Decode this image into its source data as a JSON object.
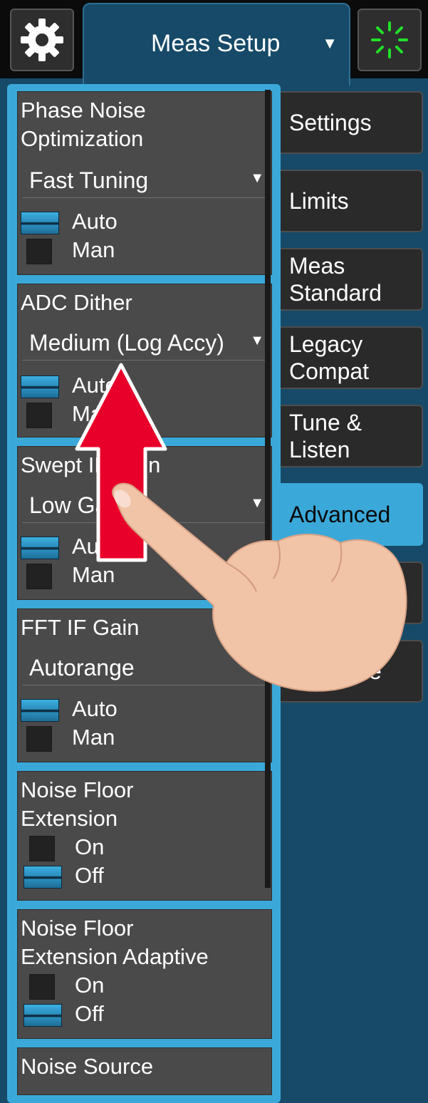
{
  "header": {
    "title": "Meas Setup",
    "title_caret": "▼",
    "settings_icon": "gear-icon",
    "status_icon": "busy-spinner-icon"
  },
  "side_menu": {
    "items": [
      {
        "label_1": "Settings",
        "label_2": ""
      },
      {
        "label_1": "Limits",
        "label_2": ""
      },
      {
        "label_1": "Meas",
        "label_2": "Standard"
      },
      {
        "label_1": "Legacy",
        "label_2": "Compat"
      },
      {
        "label_1": "Tune &",
        "label_2": "Listen"
      },
      {
        "label_1": "Advanced",
        "label_2": ""
      },
      {
        "label_1": "",
        "label_2": ""
      },
      {
        "label_1": "ce",
        "label_2": ""
      }
    ],
    "active": "Advanced"
  },
  "panels": {
    "phase_noise": {
      "title_1": "Phase Noise",
      "title_2": "Optimization",
      "value": "Fast Tuning",
      "caret": "▼",
      "auto": "Auto",
      "man": "Man",
      "selected": "Auto"
    },
    "adc_dither": {
      "title": "ADC Dither",
      "value": "Medium (Log Accy)",
      "caret": "▼",
      "auto": "Auto",
      "man": "Man",
      "selected": "Auto"
    },
    "swept_if_gain": {
      "title": "Swept IF Gain",
      "value": "Low Gain",
      "caret": "▼",
      "auto": "Auto",
      "man": "Man",
      "selected": "Auto"
    },
    "fft_if_gain": {
      "title": "FFT IF Gain",
      "value": "Autorange",
      "auto": "Auto",
      "man": "Man",
      "selected": "Auto"
    },
    "nfe": {
      "title_1": "Noise Floor",
      "title_2": "Extension",
      "on": "On",
      "off": "Off",
      "selected": "Off"
    },
    "nfe_adaptive": {
      "title_1": "Noise Floor",
      "title_2": "Extension Adaptive",
      "on": "On",
      "off": "Off",
      "selected": "Off"
    },
    "noise_source": {
      "title": "Noise Source"
    }
  },
  "overlay": {
    "arrow_direction": "up",
    "arrow_color": "#e8002a",
    "hand_icon": "pointing-hand-icon"
  }
}
